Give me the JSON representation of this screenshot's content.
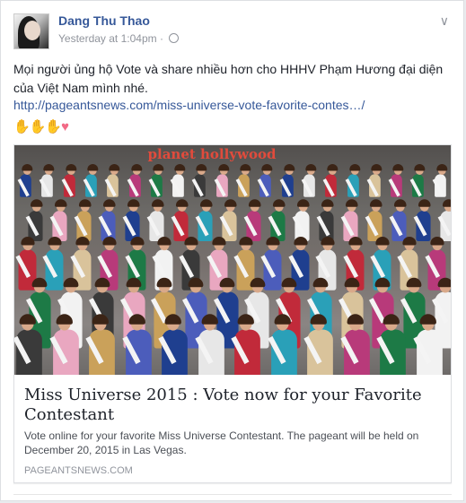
{
  "post": {
    "author": "Dang Thu Thao",
    "timestamp": "Yesterday at 1:04pm",
    "separator": "·",
    "privacy_icon": "globe-icon",
    "menu_icon": "chevron-down-icon",
    "body": "Mọi người ủng hộ Vote và share nhiều hơn cho HHHV Phạm Hương đại diện của Việt Nam mình nhé.",
    "link": "http://pageantsnews.com/miss-universe-vote-favorite-contes…/",
    "emojis": [
      "clapping-hands",
      "clapping-hands",
      "clapping-hands",
      "heart"
    ]
  },
  "card": {
    "photo_sign": "planet hollywood",
    "title": "Miss Universe 2015 : Vote now for your Favorite Contestant",
    "description": "Vote online for your favorite Miss Universe Contestant. The pageant will be held on December 20, 2015 in Las Vegas.",
    "domain": "PAGEANTSNEWS.COM"
  },
  "colors": {
    "link": "#365899",
    "text": "#1d2129",
    "muted": "#90949c",
    "border": "#dddfe2"
  }
}
